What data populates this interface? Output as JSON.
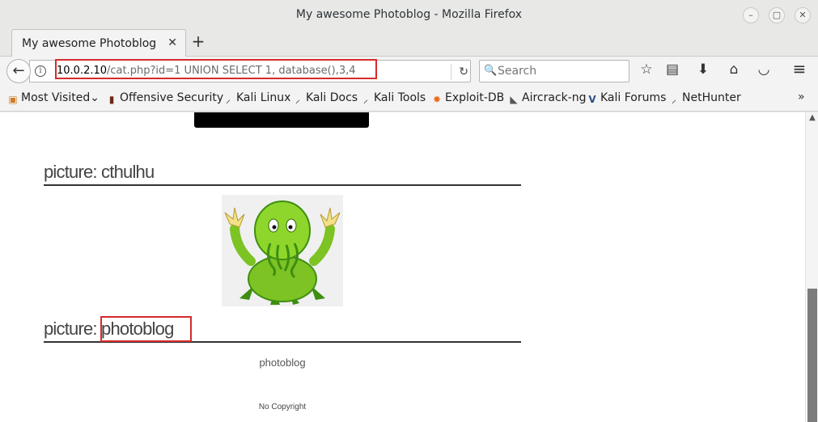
{
  "window": {
    "title": "My awesome Photoblog - Mozilla Firefox",
    "minimize_glyph": "–",
    "maximize_glyph": "▢",
    "close_glyph": "✕"
  },
  "tabs": [
    {
      "label": "My awesome Photoblog",
      "close_glyph": "✕"
    }
  ],
  "new_tab_glyph": "+",
  "nav": {
    "back_glyph": "←",
    "info_glyph": "i",
    "url_host": "10.0.2.10",
    "url_path": "/cat.php?id=1 UNION SELECT 1, database(),3,4",
    "reload_glyph": "↻",
    "search_placeholder": "Search",
    "search_icon": "🔍",
    "icons": [
      {
        "name": "bookmark-star-icon",
        "glyph": "☆"
      },
      {
        "name": "reading-list-icon",
        "glyph": "▤"
      },
      {
        "name": "downloads-icon",
        "glyph": "⬇"
      },
      {
        "name": "home-icon",
        "glyph": "⌂"
      },
      {
        "name": "pocket-icon",
        "glyph": "◡"
      },
      {
        "name": "menu-icon",
        "glyph": "≡"
      }
    ]
  },
  "bookmarks": [
    {
      "label": "Most Visited",
      "icon": "folder-icon",
      "glyph": "▣",
      "color": "#d07b24",
      "suffix": "⌄"
    },
    {
      "label": "Offensive Security",
      "icon": "offsec-icon",
      "glyph": "▮",
      "color": "#6b2a12"
    },
    {
      "label": "Kali Linux",
      "icon": "kali-dragon-icon",
      "glyph": "⸝",
      "color": "#111111"
    },
    {
      "label": "Kali Docs",
      "icon": "kali-dragon-icon",
      "glyph": "⸝",
      "color": "#111111"
    },
    {
      "label": "Kali Tools",
      "icon": "kali-dragon-icon",
      "glyph": "⸝",
      "color": "#111111"
    },
    {
      "label": "Exploit-DB",
      "icon": "exploitdb-icon",
      "glyph": "✸",
      "color": "#e86a1c"
    },
    {
      "label": "Aircrack-ng",
      "icon": "aircrack-icon",
      "glyph": "◣",
      "color": "#555555"
    },
    {
      "label": "Kali Forums",
      "icon": "kali-forums-icon",
      "glyph": "V",
      "color": "#2a4f86"
    },
    {
      "label": "NetHunter",
      "icon": "kali-dragon-icon",
      "glyph": "⸝",
      "color": "#111111"
    }
  ],
  "bookmarks_more_glyph": "»",
  "page": {
    "posts": [
      {
        "prefix": "picture:",
        "title": " cthulhu"
      },
      {
        "prefix": "picture:",
        "title": " photoblog"
      }
    ],
    "caption": "photoblog",
    "footer": "No Copyright"
  },
  "scroll": {
    "up_glyph": "▲"
  },
  "colors": {
    "highlight_red": "#d62b2b",
    "cthulhu_green": "#7cc323"
  }
}
